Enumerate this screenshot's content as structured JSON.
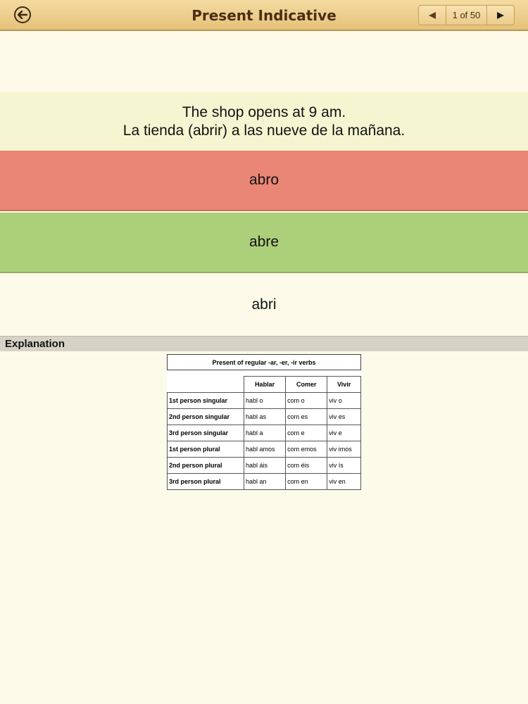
{
  "header": {
    "title": "Present Indicative",
    "pager": {
      "current": "1 of 50"
    }
  },
  "question": {
    "english": "The shop opens at 9 am.",
    "spanish": "La tienda (abrir) a las nueve de la mañana."
  },
  "options": [
    {
      "label": "abro",
      "state": "incorrect",
      "color": "#ea8676"
    },
    {
      "label": "abre",
      "state": "correct",
      "color": "#acd07a"
    },
    {
      "label": "abri",
      "state": "neutral",
      "color": "#fdfaea"
    }
  ],
  "explanation": {
    "label": "Explanation",
    "table": {
      "title": "Present of regular -ar, -er, -ir verbs",
      "columns": [
        "Hablar",
        "Comer",
        "Vivir"
      ],
      "rows": [
        {
          "person": "1st person singular",
          "hablar": "habl o",
          "comer": "com o",
          "vivir": "viv o"
        },
        {
          "person": "2nd person singular",
          "hablar": "habl as",
          "comer": "com es",
          "vivir": "viv es"
        },
        {
          "person": "3rd person singular",
          "hablar": "habl a",
          "comer": "com e",
          "vivir": "viv e"
        },
        {
          "person": "1st person plural",
          "hablar": "habl amos",
          "comer": "com emos",
          "vivir": "viv imos"
        },
        {
          "person": "2nd person plural",
          "hablar": "habl áis",
          "comer": "com éis",
          "vivir": "viv ís"
        },
        {
          "person": "3rd person plural",
          "hablar": "habl an",
          "comer": "com en",
          "vivir": "viv en"
        }
      ]
    }
  }
}
